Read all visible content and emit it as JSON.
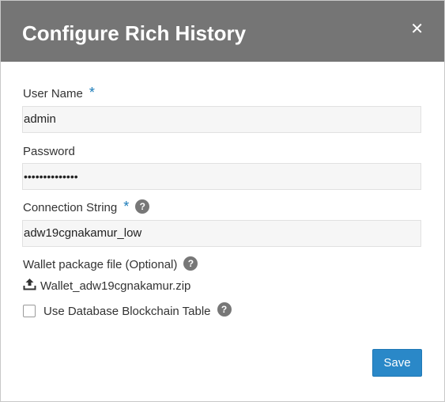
{
  "dialog": {
    "title": "Configure Rich History",
    "close_glyph": "✕"
  },
  "form": {
    "username": {
      "label": "User Name",
      "required_mark": "*",
      "value": "admin"
    },
    "password": {
      "label": "Password",
      "value": "••••••••••••••"
    },
    "connection": {
      "label": "Connection String",
      "required_mark": "*",
      "help": "?",
      "value": "adw19cgnakamur_low"
    },
    "wallet": {
      "label": "Wallet package file (Optional)",
      "help": "?",
      "file_name": "Wallet_adw19cgnakamur.zip",
      "icon": "upload-icon"
    },
    "blockchain": {
      "label": "Use Database Blockchain Table",
      "help": "?",
      "checked": false
    }
  },
  "actions": {
    "save_label": "Save"
  },
  "colors": {
    "header_bg": "#757575",
    "accent": "#2a88c8",
    "required": "#1a7bb9"
  }
}
